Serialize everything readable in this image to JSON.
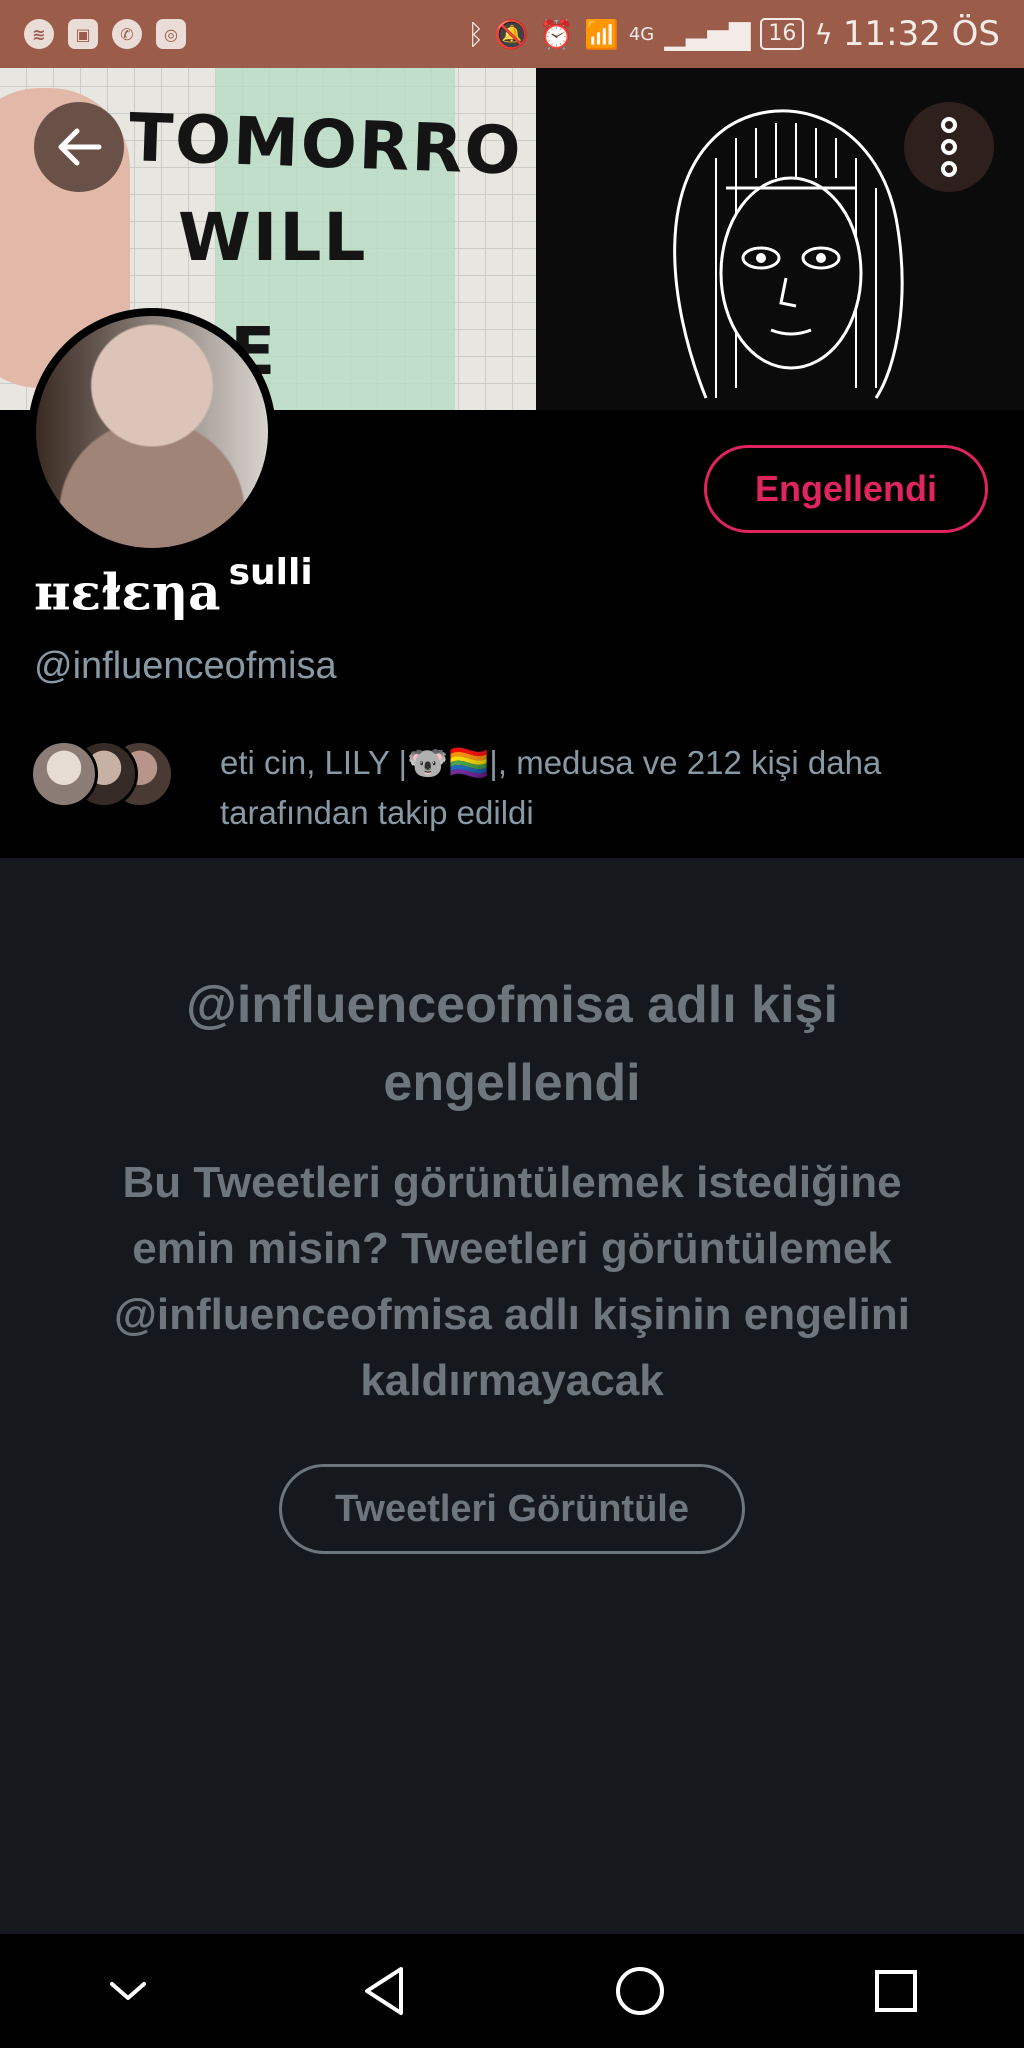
{
  "status_bar": {
    "left_icons": [
      "spotify-icon",
      "gallery-icon",
      "whatsapp-icon",
      "instagram-icon"
    ],
    "network": "4G",
    "battery": "16",
    "time": "11:32 ÖS"
  },
  "banner": {
    "handwritten_text": "TOMORROW WILL BE"
  },
  "profile": {
    "block_button_label": "Engellendi",
    "display_name": "ʜɛɫɛηa",
    "display_name_suffix": "sulli",
    "handle": "@influenceofmisa",
    "followed_by_text": "eti cin, LILY |🐨🏳️‍🌈|, medusa ve 212 kişi daha tarafından takip edildi"
  },
  "blocked": {
    "title": "@influenceofmisa adlı kişi engellendi",
    "message": "Bu Tweetleri görüntülemek istediğine emin misin? Tweetleri görüntülemek @influenceofmisa adlı kişinin engelini kaldırmayacak",
    "view_button_label": "Tweetleri Görüntüle"
  },
  "colors": {
    "status_bar": "#9b5c4a",
    "accent_red": "#e0245e",
    "muted_text": "#6e767d",
    "secondary_text": "#8899a6",
    "background": "#15181c"
  }
}
